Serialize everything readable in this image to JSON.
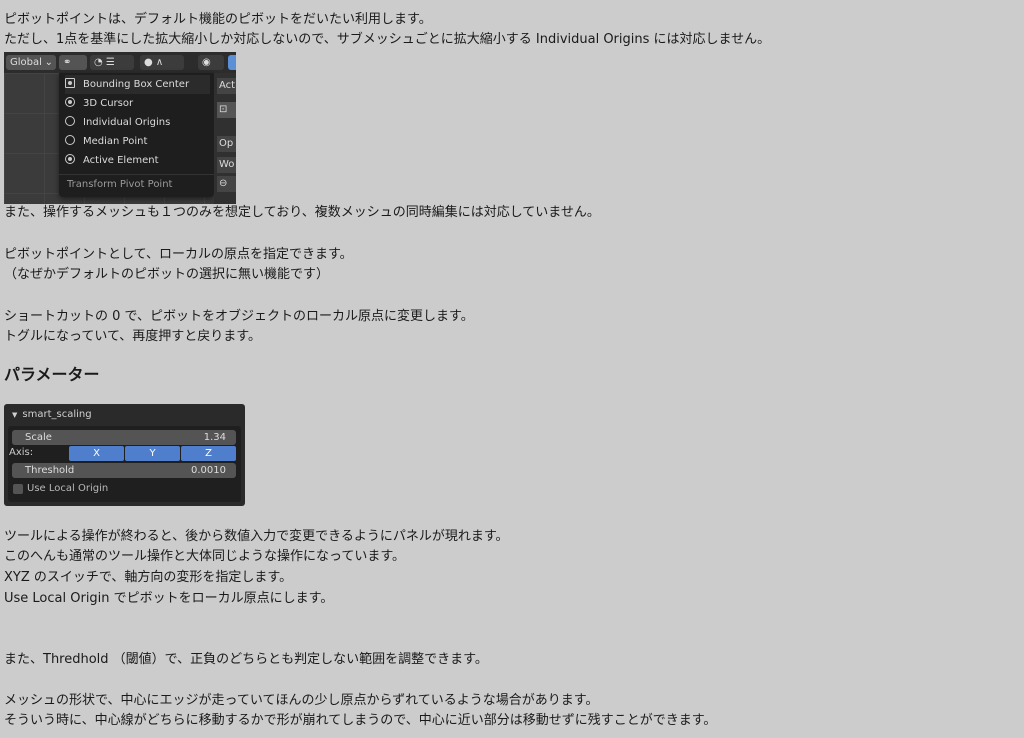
{
  "paragraphs": {
    "p1": "ピボットポイントは、デフォルト機能のピボットをだいたい利用します。",
    "p2": "ただし、1点を基準にした拡大縮小しか対応しないので、サブメッシュごとに拡大縮小する Individual Origins には対応しません。",
    "p3": "また、操作するメッシュも１つのみを想定しており、複数メッシュの同時編集には対応していません。",
    "p4": "ピボットポイントとして、ローカルの原点を指定できます。",
    "p5": "（なぜかデフォルトのピボットの選択に無い機能です）",
    "p6": "ショートカットの 0 で、ピボットをオブジェクトのローカル原点に変更します。",
    "p7": "トグルになっていて、再度押すと戻ります。",
    "heading": "パラメーター",
    "p8": "ツールによる操作が終わると、後から数値入力で変更できるようにパネルが現れます。",
    "p9": "このへんも通常のツール操作と大体同じような操作になっています。",
    "p10": "XYZ のスイッチで、軸方向の変形を指定します。",
    "p11": "Use Local Origin でピボットをローカル原点にします。",
    "p12": "また、Thredhold （閾値）で、正負のどちらとも判定しない範囲を調整できます。",
    "p13": "メッシュの形状で、中心にエッジが走っていてほんの少し原点からずれているような場合があります。",
    "p14": "そういう時に、中心線がどちらに移動するかで形が崩れてしまうので、中心に近い部分は移動せずに残すことができます。"
  },
  "pivot_shot": {
    "orientation": "Global",
    "side_labels": [
      "Act",
      "Op",
      "Wo"
    ],
    "menu_items": [
      "Bounding Box Center",
      "3D Cursor",
      "Individual Origins",
      "Median Point",
      "Active Element"
    ],
    "menu_title": "Transform Pivot Point",
    "colors": {
      "bg": "#3b3b3b",
      "menu": "#1e1e1e",
      "accent": "#5b8fd6"
    }
  },
  "panel_shot": {
    "title": "smart_scaling",
    "scale_label": "Scale",
    "scale_value": "1.34",
    "axis_label": "Axis:",
    "axis_buttons": [
      "X",
      "Y",
      "Z"
    ],
    "threshold_label": "Threshold",
    "threshold_value": "0.0010",
    "local_origin_label": "Use Local Origin",
    "colors": {
      "axis_active": "#4f7fcc",
      "field": "#545454"
    }
  }
}
